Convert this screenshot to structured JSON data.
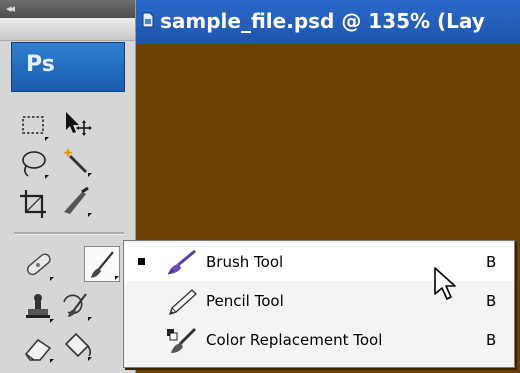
{
  "app": {
    "logo_text": "Ps",
    "collapse_glyph": "◂◂"
  },
  "document": {
    "title": "sample_file.psd @ 135% (Lay",
    "canvas_color": "#6b3f00"
  },
  "tools": [
    {
      "name": "marquee-tool",
      "icon": "dashed-rect-icon"
    },
    {
      "name": "move-tool",
      "icon": "move-arrow-icon"
    },
    {
      "name": "lasso-tool",
      "icon": "lasso-icon"
    },
    {
      "name": "magic-wand-tool",
      "icon": "magic-wand-icon"
    },
    {
      "name": "crop-tool",
      "icon": "crop-icon"
    },
    {
      "name": "slice-tool",
      "icon": "slice-knife-icon"
    },
    {
      "name": "healing-brush-tool",
      "icon": "bandage-icon"
    },
    {
      "name": "brush-tool",
      "icon": "brush-icon",
      "selected": true
    },
    {
      "name": "clone-stamp-tool",
      "icon": "stamp-icon"
    },
    {
      "name": "history-brush-tool",
      "icon": "history-brush-icon"
    },
    {
      "name": "eraser-tool",
      "icon": "eraser-icon"
    },
    {
      "name": "paint-bucket-tool",
      "icon": "bucket-icon"
    }
  ],
  "flyout": {
    "items": [
      {
        "label": "Brush Tool",
        "shortcut": "B",
        "active": true,
        "icon": "brush-icon"
      },
      {
        "label": "Pencil Tool",
        "shortcut": "B",
        "active": false,
        "icon": "pencil-icon"
      },
      {
        "label": "Color Replacement Tool",
        "shortcut": "B",
        "active": false,
        "icon": "color-replacement-icon"
      }
    ]
  },
  "colors": {
    "title_bar": "#1f56ad",
    "ps_logo": "#1a5cae",
    "panel": "#d6d6d6"
  }
}
